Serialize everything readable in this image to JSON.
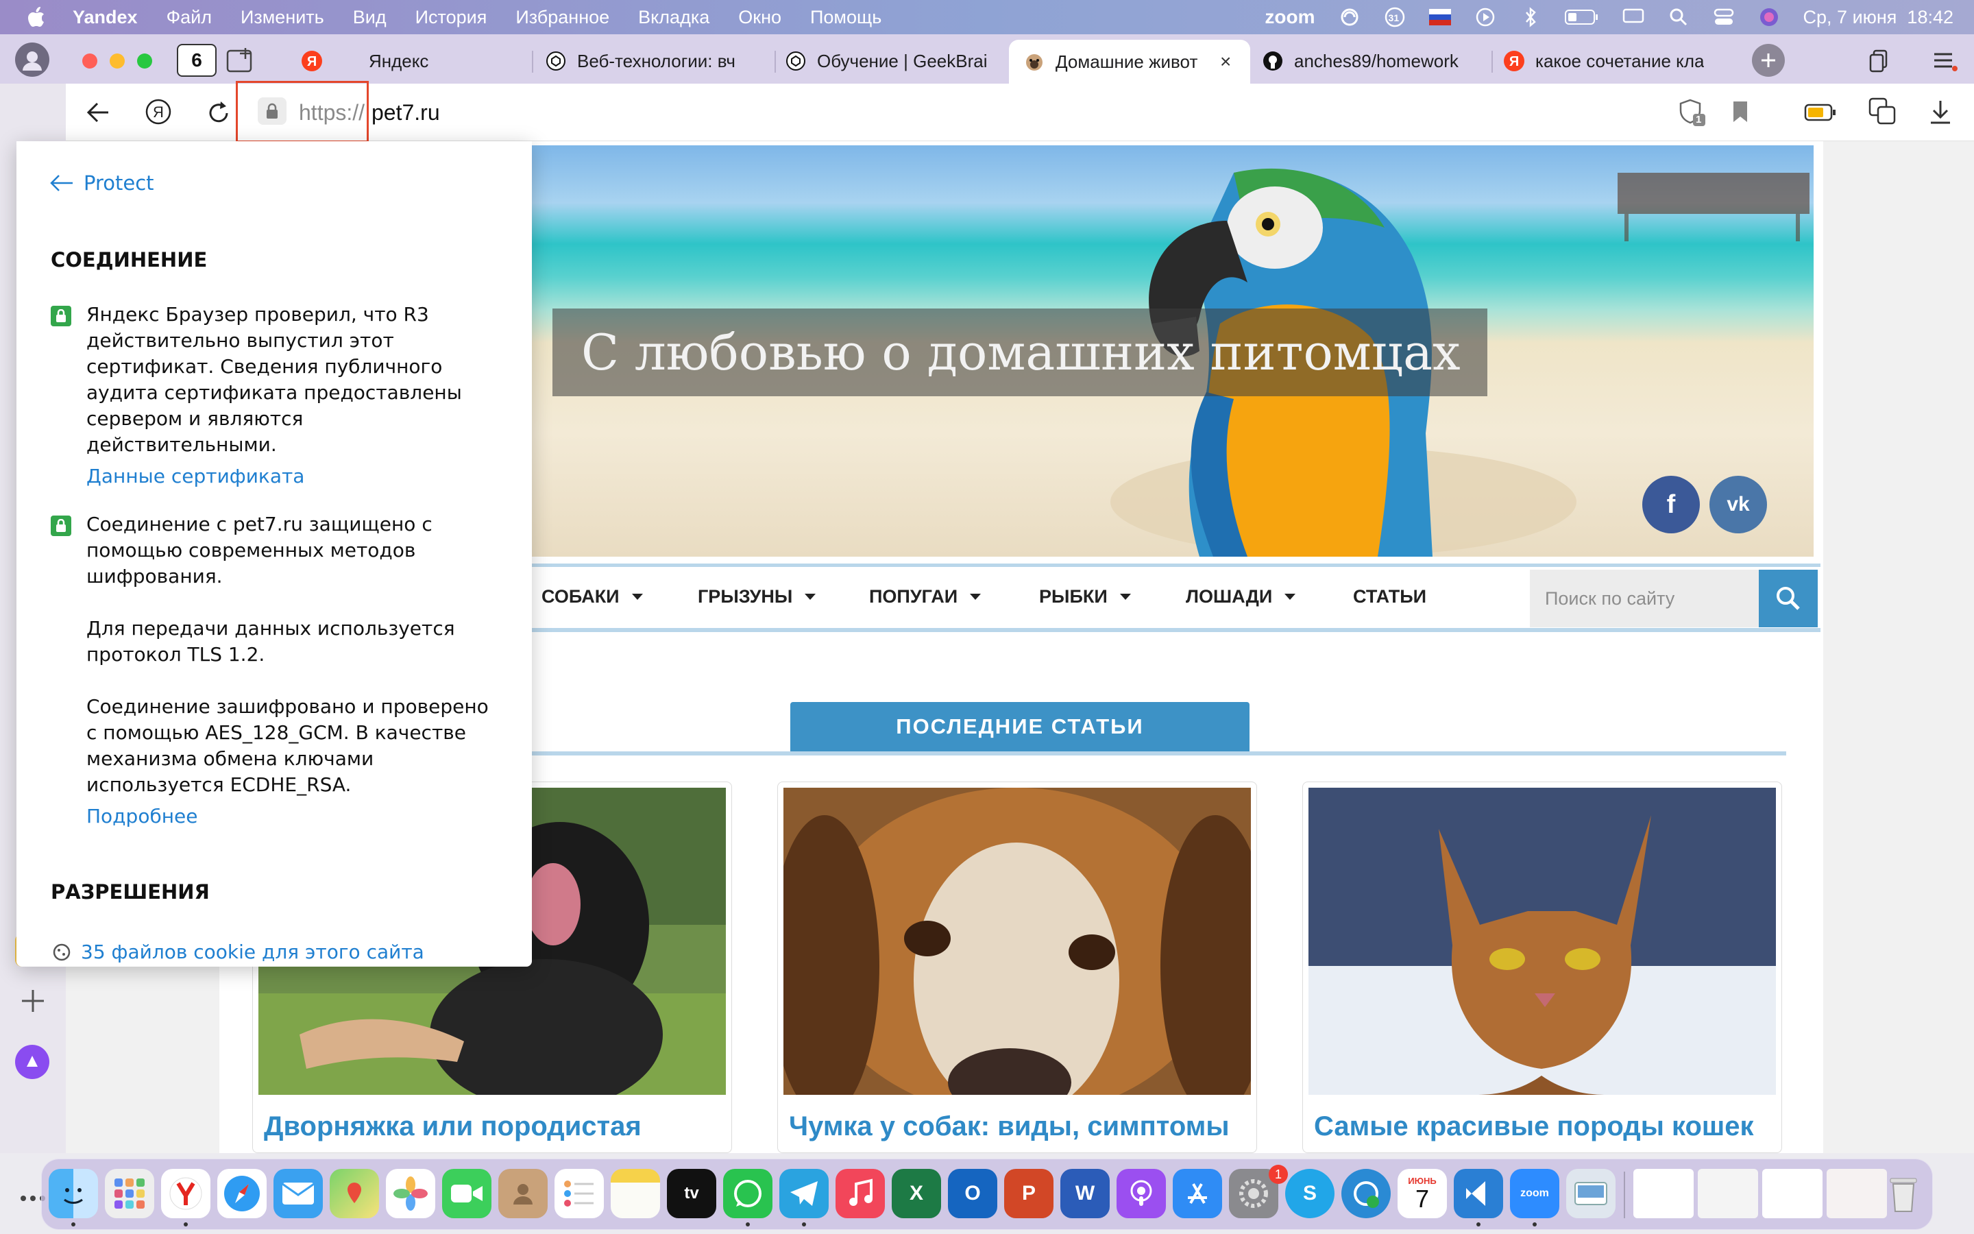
{
  "menubar": {
    "app": "Yandex",
    "items": [
      "Файл",
      "Изменить",
      "Вид",
      "История",
      "Избранное",
      "Вкладка",
      "Окно",
      "Помощь"
    ],
    "zoom_label": "zoom",
    "calendar_badge": "31",
    "datetime": "Ср, 7 июня  18:42"
  },
  "tabs": {
    "group_count": "6",
    "items": [
      {
        "title": "Яндекс",
        "favicon": "yandex-icon"
      },
      {
        "title": "Веб-технологии: вч",
        "favicon": "chatgpt-icon"
      },
      {
        "title": "Обучение | GeekBrai",
        "favicon": "chatgpt-icon"
      },
      {
        "title": "Домашние живот",
        "favicon": "pug-icon",
        "active": true
      },
      {
        "title": "anches89/homework",
        "favicon": "github-icon"
      },
      {
        "title": "какое сочетание кла",
        "favicon": "yandex-icon"
      }
    ]
  },
  "address": {
    "scheme": "https://",
    "host": "pet7.ru",
    "shield_count": "1"
  },
  "popup": {
    "back_label": "Protect",
    "connection_heading": "СОЕДИНЕНИЕ",
    "cert_lines": [
      "Яндекс Браузер проверил, что R3",
      "действительно выпустил этот",
      "сертификат. Сведения публичного",
      "аудита сертификата предоставлены",
      "сервером и являются",
      "действительными."
    ],
    "cert_link": "Данные сертификата",
    "secure_lines": [
      "Соединение с pet7.ru защищено с",
      "помощью современных методов",
      "шифрования."
    ],
    "tls_lines": [
      "Для передачи данных используется",
      "протокол TLS 1.2."
    ],
    "cipher_lines": [
      "Соединение зашифровано и проверено",
      "с помощью AES_128_GCM. В качестве",
      "механизма обмена ключами",
      "используется ECDHE_RSA."
    ],
    "more_link": "Подробнее",
    "permissions_heading": "РАЗРЕШЕНИЯ",
    "cookies_link": "35 файлов cookie для этого сайта"
  },
  "site": {
    "hero_title": "С любовью о домашних питомцах",
    "social": {
      "facebook": "f",
      "vk": "vk"
    },
    "nav": [
      "СОБАКИ",
      "ГРЫЗУНЫ",
      "ПОПУГАИ",
      "РЫБКИ",
      "ЛОШАДИ",
      "СТАТЬИ"
    ],
    "search_placeholder": "Поиск по сайту",
    "section_title": "ПОСЛЕДНИЕ СТАТЬИ",
    "cards": [
      {
        "title": "Дворняжка или породистая"
      },
      {
        "title": "Чумка у собак: виды, симптомы"
      },
      {
        "title": "Самые красивые породы кошек"
      }
    ]
  },
  "dock": {
    "calendar_month": "ИЮНЬ",
    "calendar_day": "7",
    "settings_badge": "1",
    "zoom_label": "zoom"
  },
  "colors": {
    "accent_blue": "#3d92c6",
    "link_blue": "#1f7fd0",
    "lock_green": "#33a64b",
    "highlight_red": "#e4472c",
    "facebook": "#3b5998",
    "vk": "#4a76a8"
  }
}
